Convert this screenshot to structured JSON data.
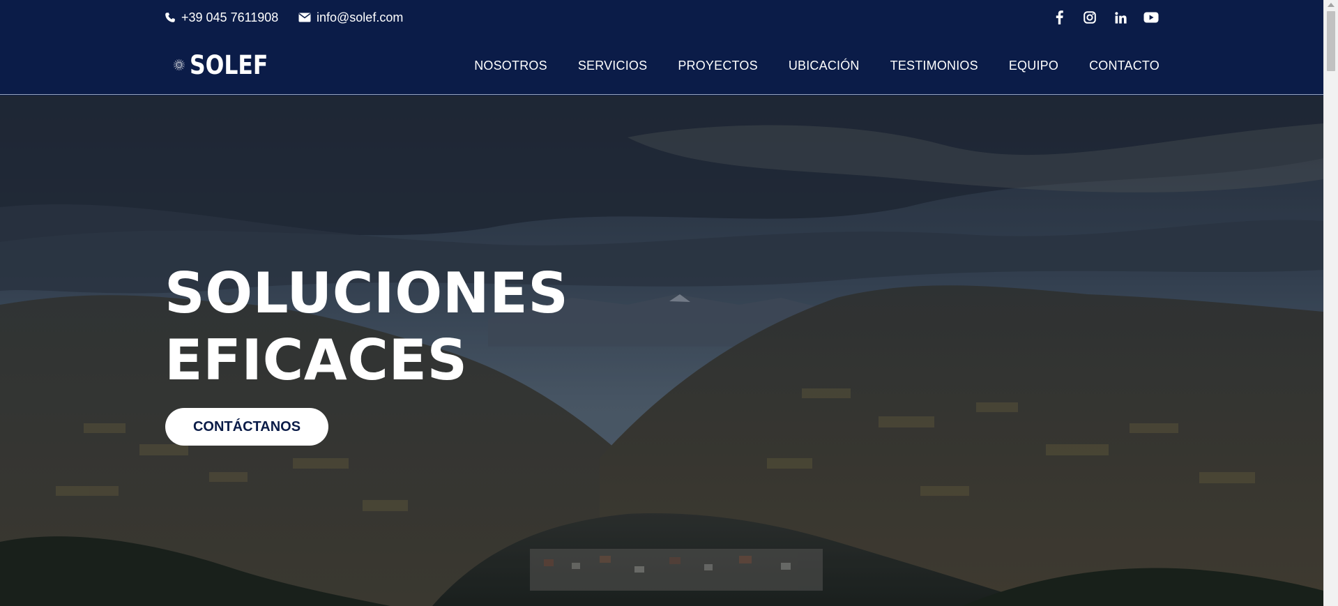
{
  "topbar": {
    "phone": "+39 045 7611908",
    "email": "info@solef.com",
    "icons": {
      "phone": "phone-icon",
      "email": "envelope-icon"
    },
    "socials": [
      "facebook-icon",
      "instagram-icon",
      "linkedin-icon",
      "youtube-icon"
    ]
  },
  "logo": {
    "text": "SOLEF",
    "icon": "sun-burst-icon"
  },
  "nav": {
    "items": [
      "NOSOTROS",
      "SERVICIOS",
      "PROYECTOS",
      "UBICACIÓN",
      "TESTIMONIOS",
      "EQUIPO",
      "CONTACTO"
    ]
  },
  "hero": {
    "title_line1": "SOLUCIONES",
    "title_line2": "EFICACES",
    "cta_label": "CONTÁCTANOS"
  },
  "colors": {
    "header_bg": "#0b1c48",
    "cta_text": "#0b1c48",
    "white": "#ffffff"
  }
}
